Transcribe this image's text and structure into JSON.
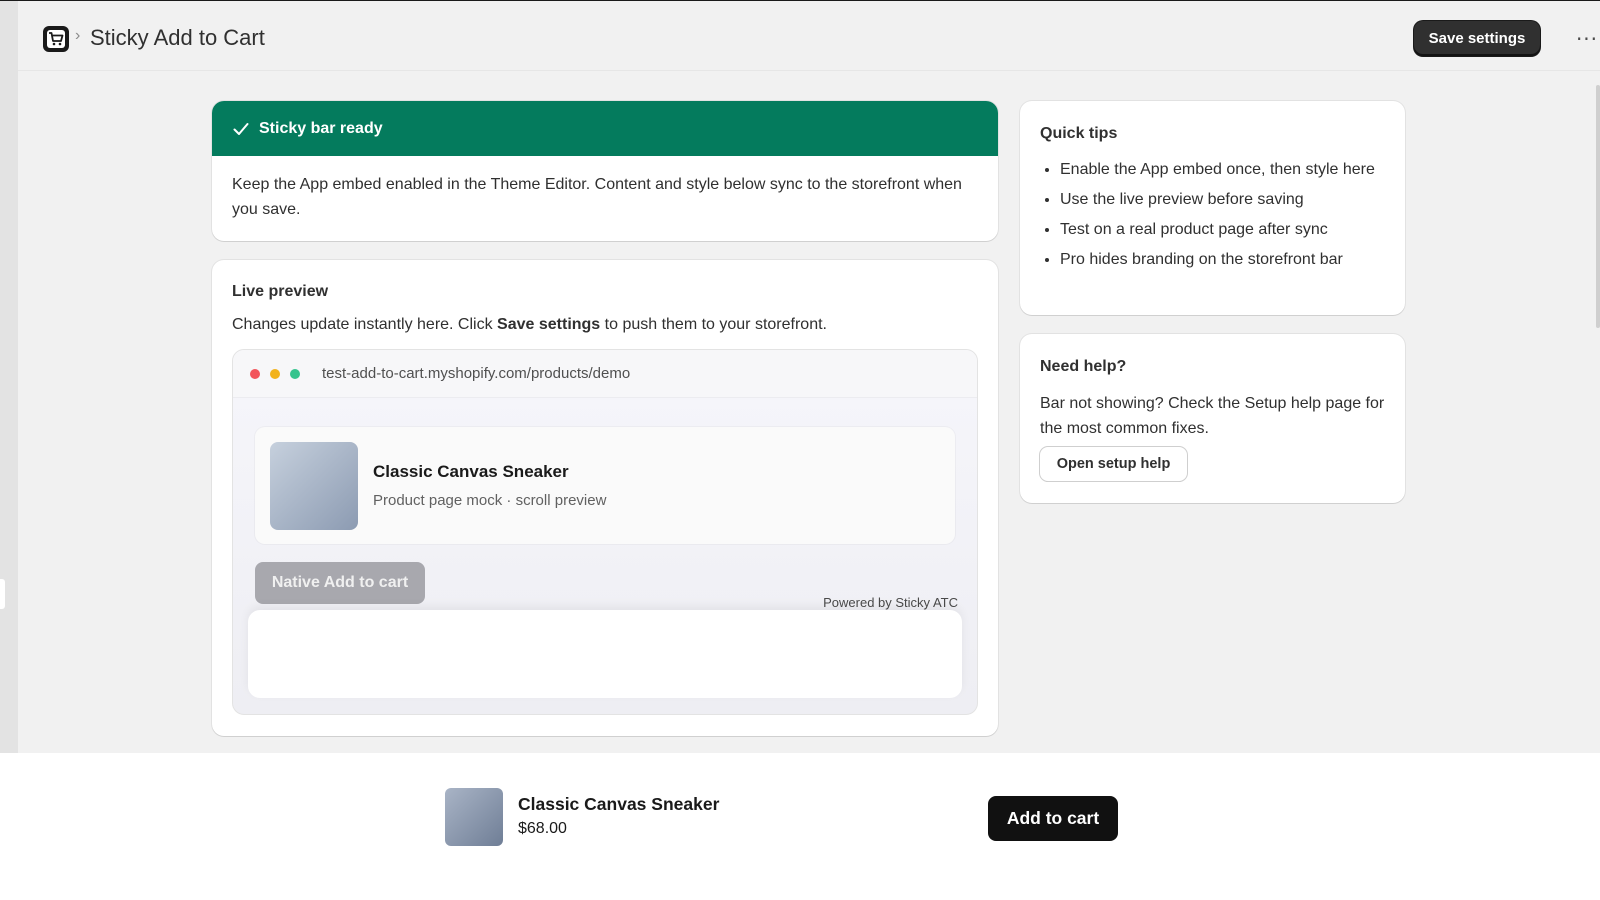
{
  "titlebar": {
    "app_icon": "cart-icon",
    "separator": "›",
    "title": "Sticky Add to Cart",
    "save_label": "Save settings",
    "more_label": "···"
  },
  "banner": {
    "icon": "checkmark-icon",
    "title": "Sticky bar ready",
    "body": "Keep the App embed enabled in the Theme Editor. Content and style below sync to the storefront when you save.",
    "color": "#047b5d"
  },
  "preview": {
    "heading": "Live preview",
    "desc_before": "Changes update instantly here. Click ",
    "desc_bold": "Save settings",
    "desc_after": " to push them to your storefront.",
    "url": "test-add-to-cart.myshopify.com/products/demo",
    "product_title": "Classic Canvas Sneaker",
    "product_sub": "Product page mock · scroll preview",
    "native_button": "Native Add to cart",
    "powered_by": "Powered by Sticky ATC"
  },
  "tips": {
    "heading": "Quick tips",
    "items": [
      "Enable the App embed once, then style here",
      "Use the live preview before saving",
      "Test on a real product page after sync",
      "Pro hides branding on the storefront bar"
    ]
  },
  "help": {
    "heading": "Need help?",
    "text": "Bar not showing? Check the Setup help page for the most common fixes.",
    "button": "Open setup help"
  },
  "sticky_bar": {
    "product_title": "Classic Canvas Sneaker",
    "price": "$68.00",
    "button": "Add to cart"
  }
}
